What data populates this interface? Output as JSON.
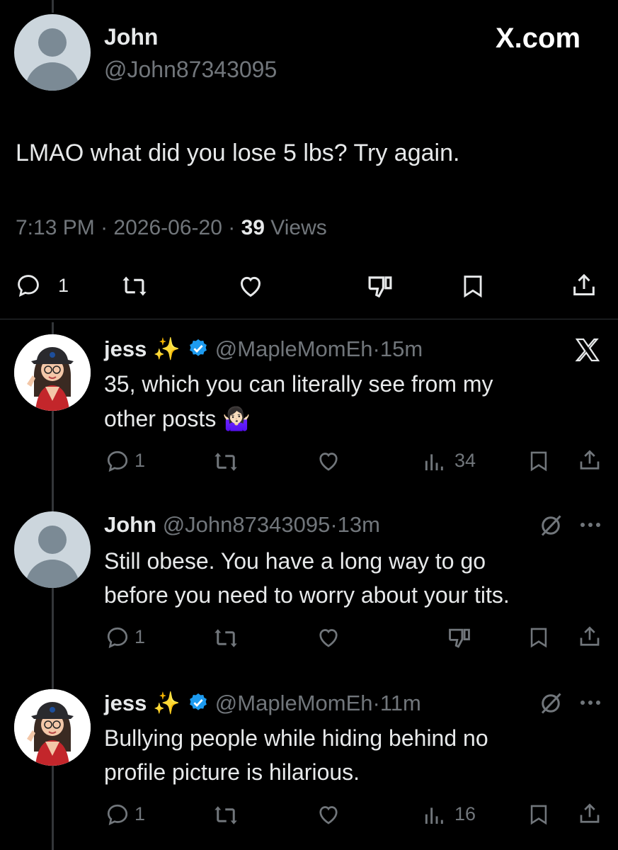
{
  "main_tweet": {
    "author_name": "John",
    "author_handle": "@John87343095",
    "brand": "X.com",
    "text": "LMAO what did you lose 5 lbs?  Try again.",
    "time": "7:13 PM",
    "date": "2026-06-20",
    "sep": "·",
    "views_count": "39",
    "views_label": "Views",
    "reply_count": "1"
  },
  "replies": [
    {
      "author_name": "jess ✨",
      "author_handle": "@MapleMomEh",
      "time": "15m",
      "sep": "·",
      "text_line1": "35, which you can literally see from my",
      "text_line2": "other posts 🤷🏻‍♀️",
      "reply_count": "1",
      "views_count": "34",
      "corner_icon": "x-logo-icon"
    },
    {
      "author_name": "John",
      "author_handle": "@John87343095",
      "time": "13m",
      "sep": "·",
      "text_line1": "Still obese.  You have a long way to go",
      "text_line2": "before you need to worry about your tits.",
      "reply_count": "1",
      "corner_icon": "grok-icon"
    },
    {
      "author_name": "jess ✨",
      "author_handle": "@MapleMomEh",
      "time": "11m",
      "sep": "·",
      "text_line1": "Bullying people while hiding behind no",
      "text_line2": "profile picture is hilarious.",
      "reply_count": "1",
      "views_count": "16",
      "corner_icon": "grok-icon"
    }
  ],
  "colors": {
    "background": "#000000",
    "text": "#e7e9ea",
    "muted": "#71767b",
    "verified": "#1d9bf0",
    "thread_line": "#333639"
  }
}
